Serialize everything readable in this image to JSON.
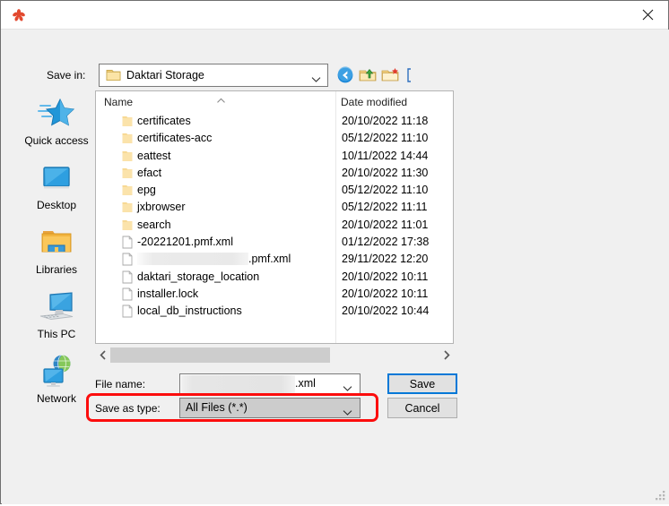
{
  "window": {
    "title": "",
    "app_icon": "asterisk-flower-icon",
    "close_label": "✕"
  },
  "savein": {
    "label": "Save in:",
    "value": "Daktari Storage",
    "icon": "folder-icon",
    "caret": "chevron-down-icon"
  },
  "toolbar": {
    "buttons": [
      {
        "name": "back-button",
        "icon": "back-arrow-icon"
      },
      {
        "name": "up-one-level-button",
        "icon": "up-folder-icon"
      },
      {
        "name": "create-new-folder-button",
        "icon": "new-folder-icon"
      },
      {
        "name": "views-button",
        "icon": "views-icon"
      }
    ]
  },
  "places": [
    {
      "label": "Quick access",
      "icon": "quick-access-star-icon"
    },
    {
      "label": "Desktop",
      "icon": "desktop-monitor-icon"
    },
    {
      "label": "Libraries",
      "icon": "libraries-folder-icon"
    },
    {
      "label": "This PC",
      "icon": "this-pc-icon"
    },
    {
      "label": "Network",
      "icon": "network-globe-icon"
    }
  ],
  "filelist": {
    "columns": [
      "Name",
      "Date modified"
    ],
    "sort": {
      "column": "Name",
      "direction": "ascending",
      "icon": "sort-ascending-caret-icon"
    },
    "rows": [
      {
        "name": "certificates",
        "type": "folder",
        "redacted": false,
        "date": "20/10/2022 11:18"
      },
      {
        "name": "certificates-acc",
        "type": "folder",
        "redacted": false,
        "date": "05/12/2022 11:10"
      },
      {
        "name": "eattest",
        "type": "folder",
        "redacted": false,
        "date": "10/11/2022 14:44"
      },
      {
        "name": "efact",
        "type": "folder",
        "redacted": false,
        "date": "20/10/2022 11:30"
      },
      {
        "name": "epg",
        "type": "folder",
        "redacted": false,
        "date": "05/12/2022 11:10"
      },
      {
        "name": "jxbrowser",
        "type": "folder",
        "redacted": false,
        "date": "05/12/2022 11:11"
      },
      {
        "name": "search",
        "type": "folder",
        "redacted": false,
        "date": "20/10/2022 11:01"
      },
      {
        "name": "-20221201.pmf.xml",
        "type": "file",
        "redacted": false,
        "date": "01/12/2022 17:38"
      },
      {
        "name": ".pmf.xml",
        "type": "file",
        "redacted": true,
        "date": "29/11/2022 12:20"
      },
      {
        "name": "daktari_storage_location",
        "type": "file",
        "redacted": false,
        "date": "20/10/2022 10:11"
      },
      {
        "name": "installer.lock",
        "type": "file",
        "redacted": false,
        "date": "20/10/2022 10:11"
      },
      {
        "name": "local_db_instructions",
        "type": "file",
        "redacted": false,
        "date": "20/10/2022 10:44"
      }
    ]
  },
  "scrollbar": {
    "left_icon": "chevron-left-icon",
    "right_icon": "chevron-right-icon"
  },
  "filename": {
    "label": "File name:",
    "value": ".xml",
    "redacted": true,
    "caret": "chevron-down-icon"
  },
  "savetype": {
    "label": "Save as type:",
    "value": "All Files (*.*)",
    "caret": "chevron-down-icon"
  },
  "actions": {
    "save_label": "Save",
    "cancel_label": "Cancel"
  },
  "annotation": {
    "highlight_color": "#fc0d0d",
    "target": "save-as-type-row"
  }
}
